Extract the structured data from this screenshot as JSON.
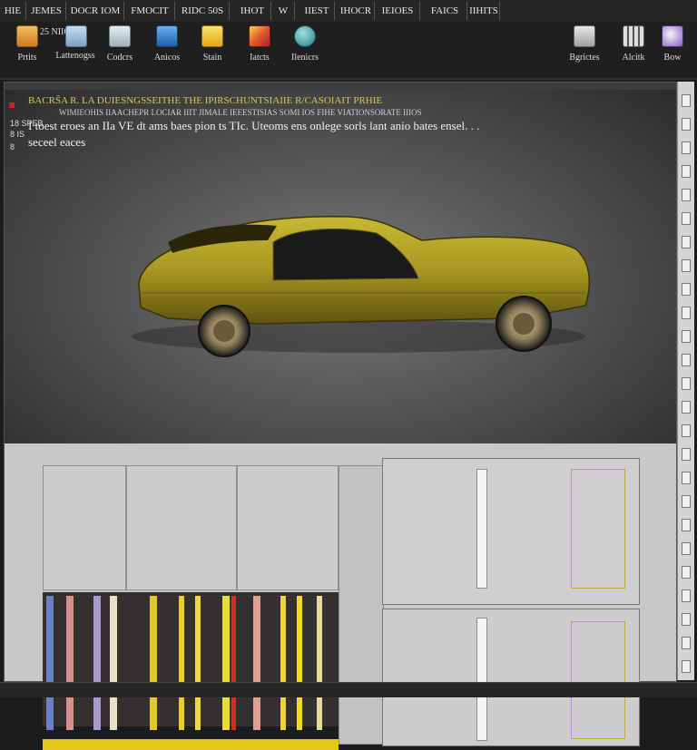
{
  "tabs": [
    "HIE",
    "JEMES",
    "DOCR IOM",
    "FMOCIT",
    "RIDC 50S",
    "IHOT",
    "W",
    "IIEST",
    "IHOCR",
    "IEIOES",
    "FAICS",
    "IIHITS"
  ],
  "ribbon": {
    "left": [
      {
        "label": "Prtits",
        "icon": "document-icon",
        "color": "#e4a02a"
      },
      {
        "label": "Lattenogss",
        "icon": "document-stack-icon",
        "color": "#8fb3d8",
        "top": "25 NIIOS"
      },
      {
        "label": "Codcrs",
        "icon": "image-icon",
        "color": "#b8c4cc"
      },
      {
        "label": "Anicos",
        "icon": "cube-icon",
        "color": "#3c8ad8"
      },
      {
        "label": "Stain",
        "icon": "note-icon",
        "color": "#f2c21e"
      },
      {
        "label": "Iatcts",
        "icon": "photo-icon",
        "color": "#d8452a"
      },
      {
        "label": "Ilenicrs",
        "icon": "globe-icon",
        "color": "#3aa3a0"
      }
    ],
    "right": [
      {
        "label": "Bgrictes",
        "icon": "window-icon",
        "color": "#c8c8c8"
      },
      {
        "label": "Alcitk",
        "icon": "grid-icon",
        "color": "#d0d0d0"
      },
      {
        "label": "Bow",
        "icon": "paint-icon",
        "color": "#9060c8"
      }
    ]
  },
  "document": {
    "line1": "BACRS̃A R. LA DUIESNGSSEITHE THE IPIRSCHUNTSIAIIE R/CASOIAIT PRHIE",
    "line2": "WIMIEOHIS IIAACHEPR LOCIAR IIIT  JIMALE IEEESTISIAS SOMI IOS FIHE VIATIONSORATE IIIOS",
    "line3": "I toest eroes an IIa VE dt ams baes pion ts  TIc. Uteoms ens onlege sorls lant anio bates ensel. . .",
    "line4": "seceel eaces",
    "side_nums": [
      "18 SPEB",
      "8 IS",
      "8"
    ]
  }
}
